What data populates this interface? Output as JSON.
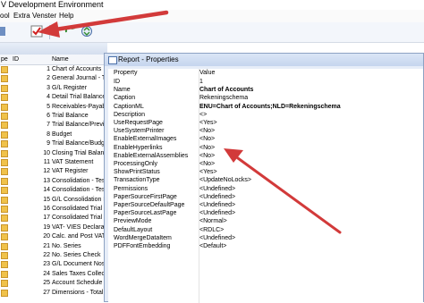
{
  "window": {
    "title": "V Development Environment"
  },
  "menu": [
    "ool",
    "Extra",
    "Venster",
    "Help"
  ],
  "left_list": {
    "columns": [
      "pe",
      "ID",
      "Name"
    ],
    "rows": [
      {
        "num": "1",
        "name": "Chart of Accounts"
      },
      {
        "num": "2",
        "name": "General Journal - Tes"
      },
      {
        "num": "3",
        "name": "G/L Register"
      },
      {
        "num": "4",
        "name": "Detail Trial Balance"
      },
      {
        "num": "5",
        "name": "Receivables-Payable"
      },
      {
        "num": "6",
        "name": "Trial Balance"
      },
      {
        "num": "7",
        "name": "Trial Balance/Previou"
      },
      {
        "num": "8",
        "name": "Budget"
      },
      {
        "num": "9",
        "name": "Trial Balance/Budget"
      },
      {
        "num": "10",
        "name": "Closing Trial Balance"
      },
      {
        "num": "11",
        "name": "VAT Statement"
      },
      {
        "num": "12",
        "name": "VAT Register"
      },
      {
        "num": "13",
        "name": "Consolidation - Test B"
      },
      {
        "num": "14",
        "name": "Consolidation - Test F"
      },
      {
        "num": "15",
        "name": "G/L Consolidation Eli"
      },
      {
        "num": "16",
        "name": "Consolidated Trial Ba"
      },
      {
        "num": "17",
        "name": "Consolidated Trial Ba"
      },
      {
        "num": "19",
        "name": "VAT- VIES Declaratio"
      },
      {
        "num": "20",
        "name": "Calc. and Post VAT S"
      },
      {
        "num": "21",
        "name": "No. Series"
      },
      {
        "num": "22",
        "name": "No. Series Check"
      },
      {
        "num": "23",
        "name": "G/L Document Nos."
      },
      {
        "num": "24",
        "name": "Sales Taxes Collecte"
      },
      {
        "num": "25",
        "name": "Account Schedule"
      },
      {
        "num": "27",
        "name": "Dimensions - Total"
      }
    ]
  },
  "properties": {
    "title": "Report - Properties",
    "columns": [
      "Property",
      "Value"
    ],
    "rows": [
      {
        "prop": "ID",
        "value": "1"
      },
      {
        "prop": "Name",
        "value": "Chart of Accounts"
      },
      {
        "prop": "Caption",
        "value": "Rekeningschema"
      },
      {
        "prop": "CaptionML",
        "value": "ENU=Chart of Accounts;NLD=Rekeningschema"
      },
      {
        "prop": "Description",
        "value": "<>"
      },
      {
        "prop": "UseRequestPage",
        "value": "<Yes>"
      },
      {
        "prop": "UseSystemPrinter",
        "value": "<No>"
      },
      {
        "prop": "EnableExternalImages",
        "value": "<No>"
      },
      {
        "prop": "EnableHyperlinks",
        "value": "<No>"
      },
      {
        "prop": "EnableExternalAssemblies",
        "value": "<No>"
      },
      {
        "prop": "ProcessingOnly",
        "value": "<No>"
      },
      {
        "prop": "ShowPrintStatus",
        "value": "<Yes>"
      },
      {
        "prop": "TransactionType",
        "value": "<UpdateNoLocks>"
      },
      {
        "prop": "Permissions",
        "value": "<Undefined>"
      },
      {
        "prop": "PaperSourceFirstPage",
        "value": "<Undefined>"
      },
      {
        "prop": "PaperSourceDefaultPage",
        "value": "<Undefined>"
      },
      {
        "prop": "PaperSourceLastPage",
        "value": "<Undefined>"
      },
      {
        "prop": "PreviewMode",
        "value": "<Normal>"
      },
      {
        "prop": "DefaultLayout",
        "value": "<RDLC>"
      },
      {
        "prop": "WordMergeDataItem",
        "value": "<Undefined>"
      },
      {
        "prop": "PDFFontEmbedding",
        "value": "<Default>"
      }
    ]
  },
  "accent": "#d23a3a"
}
